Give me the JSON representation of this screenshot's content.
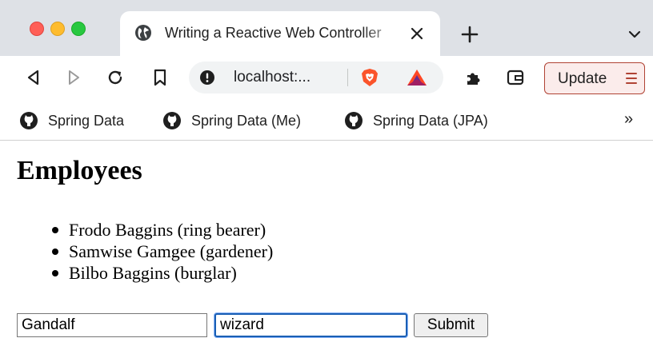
{
  "window": {
    "traffic_lights": [
      "close",
      "minimize",
      "maximize"
    ]
  },
  "tab": {
    "title": "Writing a Reactive Web Controller",
    "favicon": "globe-icon",
    "close_icon": "close-icon"
  },
  "toolbar": {
    "icons": [
      "back-icon",
      "forward-icon",
      "reload-icon",
      "bookmark-icon"
    ],
    "url": "localhost:...",
    "update_label": "Update",
    "colors": {
      "brave_orange": "#fb542b",
      "bat_red": "#ff4724",
      "bat_purple": "#662d91",
      "update_border": "#b04334"
    }
  },
  "bookmarks": {
    "items": [
      {
        "label": "Spring Data",
        "icon": "github-icon"
      },
      {
        "label": "Spring Data (Me)",
        "icon": "github-icon"
      },
      {
        "label": "Spring Data (JPA)",
        "icon": "github-icon"
      }
    ],
    "overflow": "»"
  },
  "page": {
    "title": "Employees",
    "employees": [
      "Frodo Baggins (ring bearer)",
      "Samwise Gamgee (gardener)",
      "Bilbo Baggins (burglar)"
    ],
    "form": {
      "name_value": "Gandalf",
      "role_value": "wizard",
      "submit_label": "Submit"
    }
  }
}
